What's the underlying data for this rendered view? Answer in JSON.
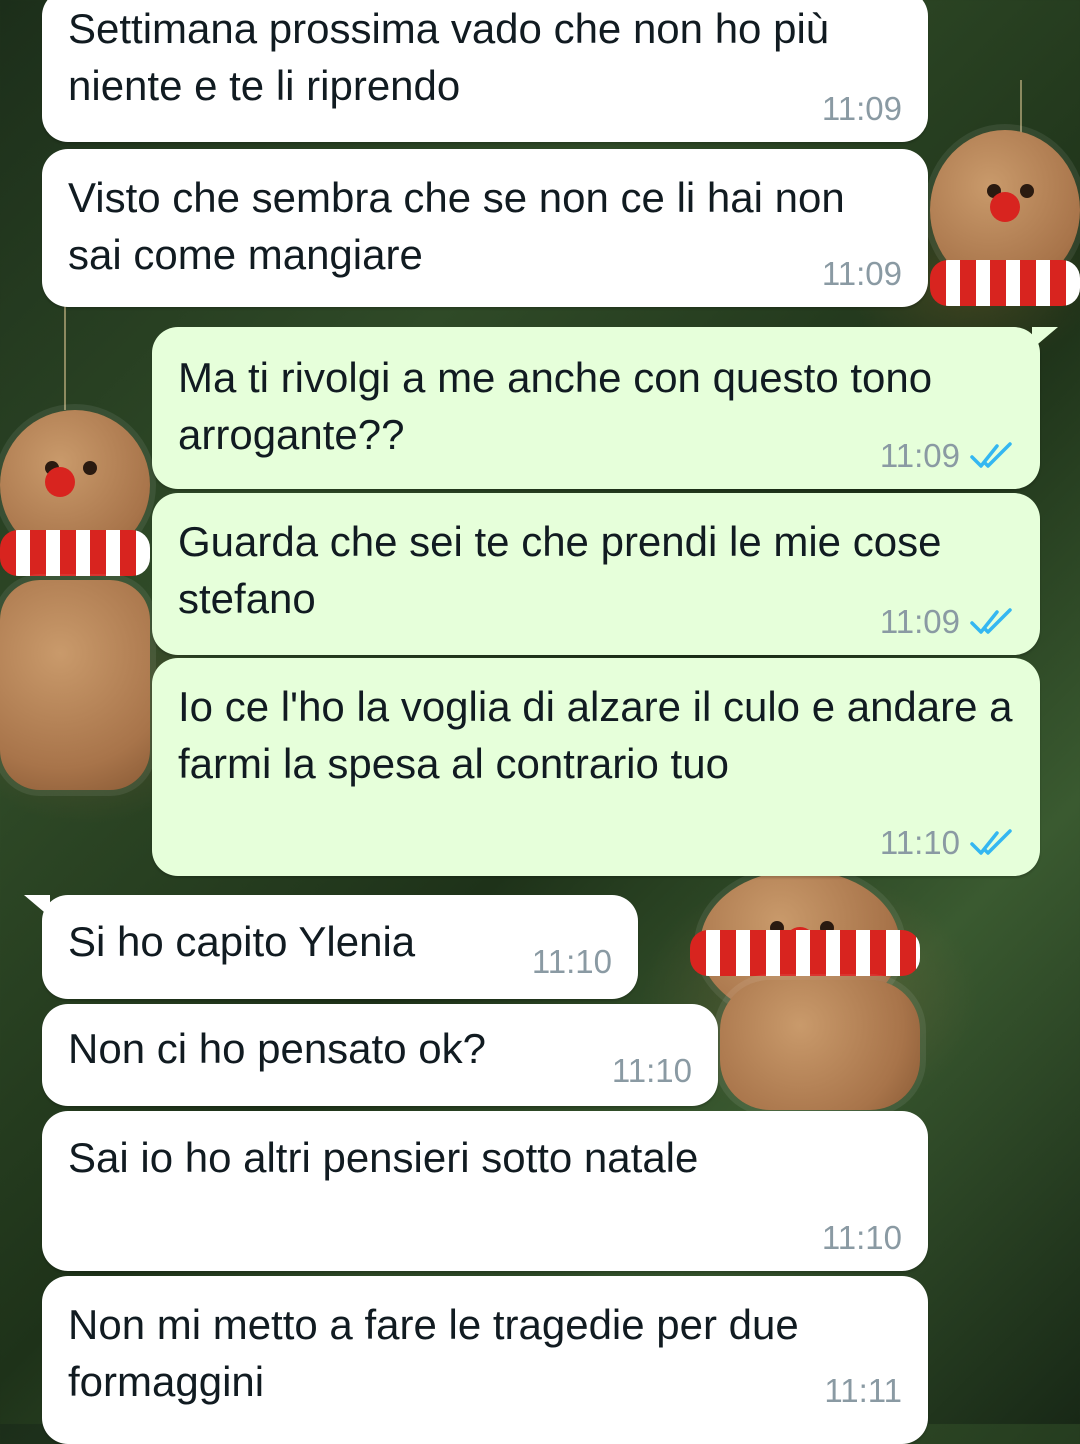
{
  "theme": {
    "incoming_bubble": "#ffffff",
    "outgoing_bubble": "#e6ffda",
    "text_color": "#111b21",
    "time_color": "#8a9aa3",
    "read_tick_color": "#34b7f1"
  },
  "messages": [
    {
      "direction": "in",
      "text": "Settimana prossima vado che non ho più niente e te li riprendo",
      "time": "11:09"
    },
    {
      "direction": "in",
      "text": "Visto che sembra che se non ce li hai non sai come mangiare",
      "time": "11:09"
    },
    {
      "direction": "out",
      "text": "Ma ti rivolgi a me anche con questo tono arrogante??",
      "time": "11:09",
      "status": "read"
    },
    {
      "direction": "out",
      "text": "Guarda che sei te che prendi le mie cose stefano",
      "time": "11:09",
      "status": "read"
    },
    {
      "direction": "out",
      "text": "Io ce l'ho la voglia di alzare il culo e andare a farmi la spesa al contrario tuo",
      "time": "11:10",
      "status": "read"
    },
    {
      "direction": "in",
      "text": "Si ho capito Ylenia",
      "time": "11:10"
    },
    {
      "direction": "in",
      "text": "Non ci ho pensato ok?",
      "time": "11:10"
    },
    {
      "direction": "in",
      "text": "Sai io ho altri pensieri sotto natale",
      "time": "11:10"
    },
    {
      "direction": "in",
      "text": "Non mi metto a fare le tragedie per due formaggini",
      "time": "11:11"
    }
  ]
}
